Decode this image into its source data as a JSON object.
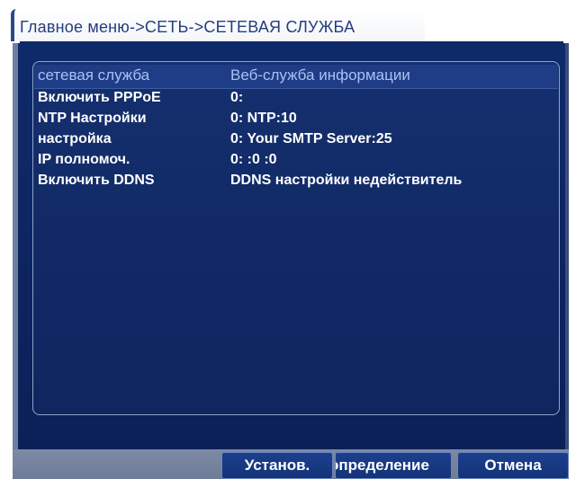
{
  "breadcrumb": "Главное меню->СЕТЬ->СЕТЕВАЯ СЛУЖБА",
  "table": {
    "headers": [
      "сетевая служба",
      "Веб-служба информации"
    ],
    "rows": [
      {
        "service": "Включить PPPoE",
        "info": "0:"
      },
      {
        "service": "NTP Настройки",
        "info": "0: NTP:10"
      },
      {
        "service": "настройка",
        "info": "0: Your SMTP Server:25"
      },
      {
        "service": "IP полномоч.",
        "info": "0: :0 :0"
      },
      {
        "service": "Включить DDNS",
        "info": "DDNS настройки недействитель"
      }
    ]
  },
  "buttons": {
    "set": "Установ.",
    "detect": "определение",
    "cancel": "Отмена"
  },
  "colors": {
    "panel": "#0f2a6a",
    "header_text": "#a9c2f2",
    "title_text": "#233e7c"
  }
}
